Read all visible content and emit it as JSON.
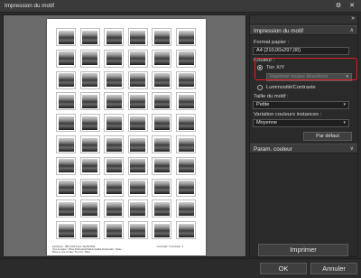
{
  "window": {
    "title": "Impression du motif",
    "settings_icon": "gear-icon",
    "close_icon": "close-icon"
  },
  "preview": {
    "footer_left_line1": "Imprimante : PRO-1000 series / My-Mt-5048",
    "footer_left_line2": "Type de papier : Photo Professional Platine    Qualité d'impression : Haute",
    "footer_left_line3": "Photo en noir et blanc : Non    Ton : Blanc",
    "footer_right": "Luminosité : 0    Contraste : 0"
  },
  "panel": {
    "collapse_icon": "double-chevron-right-icon",
    "section1_title": "Impression du motif",
    "section1_chevron": "∧",
    "paper_label": "Format papier :",
    "paper_value": "A4 (210,00x297,00)",
    "color_label": "Couleur :",
    "radio1_label": "Ton X/Y",
    "direction_value": "Imprimer toutes directions",
    "radio2_label": "Luminosité/Contraste",
    "size_label": "Taille du motif :",
    "size_value": "Petite",
    "variation_label": "Variation couleurs instances :",
    "variation_value": "Moyenne",
    "default_button": "Par défaut",
    "section2_title": "Param. couleur",
    "section2_chevron": "∨",
    "print_button": "Imprimer"
  },
  "footer": {
    "ok_button": "OK",
    "cancel_button": "Annuler"
  },
  "colors": {
    "background": "#2b2b2b",
    "highlight": "#e0202a"
  }
}
